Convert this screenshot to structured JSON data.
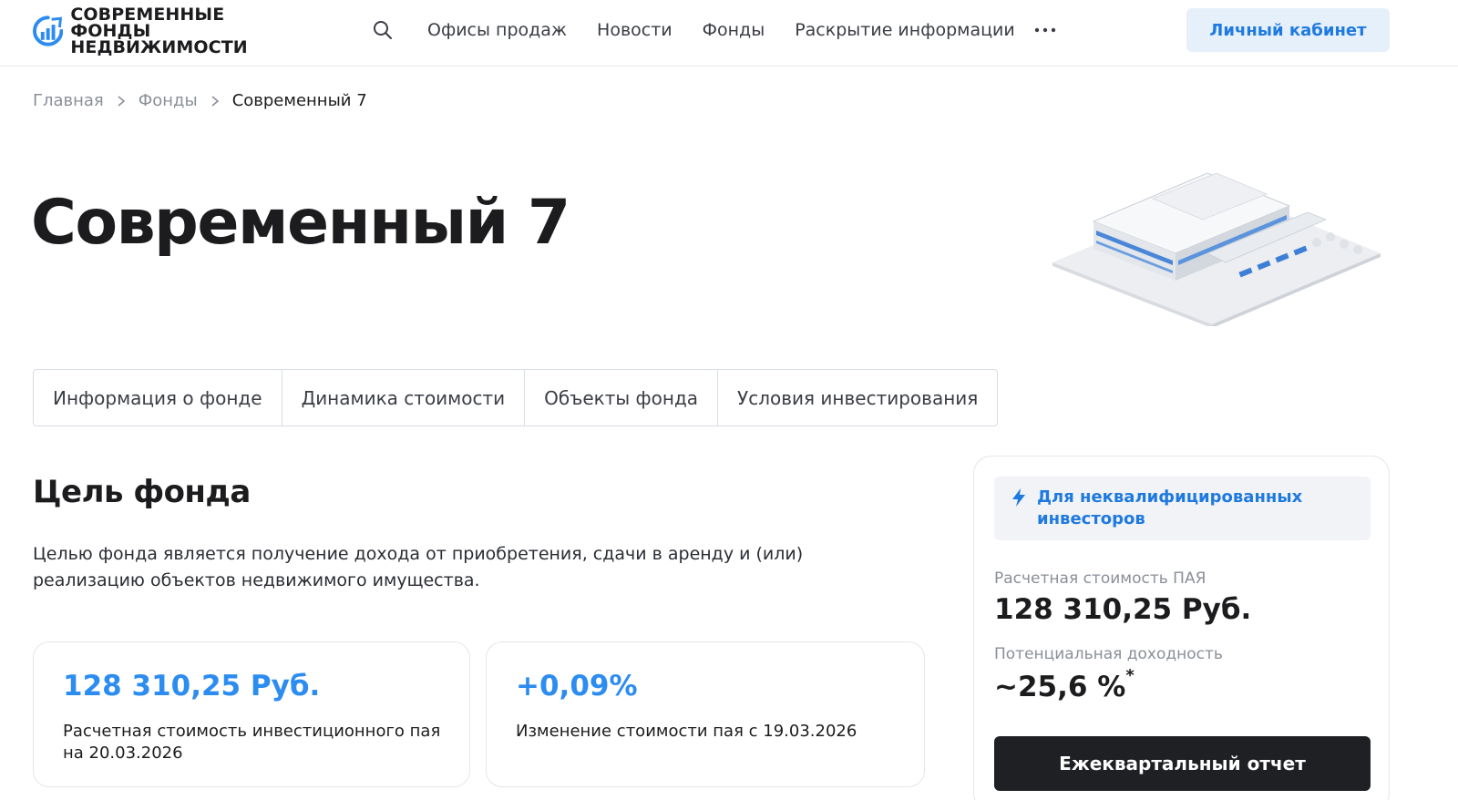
{
  "header": {
    "logo_line1": "СОВРЕМЕННЫЕ ФОНДЫ",
    "logo_line2": "НЕДВИЖИМОСТИ",
    "nav": [
      {
        "label": "Офисы продаж"
      },
      {
        "label": "Новости"
      },
      {
        "label": "Фонды"
      },
      {
        "label": "Раскрытие информации"
      }
    ],
    "cabinet_label": "Личный кабинет"
  },
  "breadcrumb": {
    "home": "Главная",
    "funds": "Фонды",
    "current": "Современный 7"
  },
  "page_title": "Современный 7",
  "tabs": [
    {
      "label": "Информация о фонде"
    },
    {
      "label": "Динамика стоимости"
    },
    {
      "label": "Объекты фонда"
    },
    {
      "label": "Условия инвестирования"
    }
  ],
  "goal": {
    "title": "Цель фонда",
    "text": "Целью фонда является получение дохода от приобретения, сдачи в аренду и (или) реализацию объектов недвижимого имущества."
  },
  "stats": [
    {
      "value": "128 310,25 Руб.",
      "label": "Расчетная стоимость инвестиционного пая на 20.03.2026"
    },
    {
      "value": "+0,09%",
      "label": "Изменение стоимости пая с 19.03.2026"
    }
  ],
  "side": {
    "badge": "Для неквалифицированных инвесторов",
    "price_label": "Расчетная стоимость ПАЯ",
    "price_value": "128 310,25 Руб.",
    "yield_label": "Потенциальная доходность",
    "yield_value": "~25,6 %",
    "yield_mark": "*",
    "report_label": "Ежеквартальный отчет"
  },
  "colors": {
    "accent": "#2d8cf0",
    "link_blue": "#1f7ae0",
    "button_dark": "#1f2024",
    "cabinet_bg": "#e5f0fb"
  }
}
